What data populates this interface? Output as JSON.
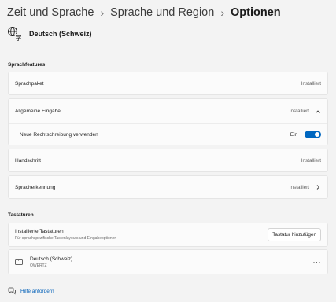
{
  "breadcrumb": {
    "items": [
      "Zeit und Sprache",
      "Sprache und Region",
      "Optionen"
    ],
    "separator": "›"
  },
  "language": {
    "name": "Deutsch (Schweiz)",
    "icon": "language-translate-icon"
  },
  "sprachfeatures": {
    "title": "Sprachfeatures",
    "sprachpaket": {
      "label": "Sprachpaket",
      "status": "Installiert"
    },
    "allgemeine_eingabe": {
      "label": "Allgemeine Eingabe",
      "status": "Installiert",
      "expanded": true,
      "spellcheck": {
        "label": "Neue Rechtschreibung verwenden",
        "state": "Ein",
        "on": true
      }
    },
    "handschrift": {
      "label": "Handschrift",
      "status": "Installiert"
    },
    "spracherkennung": {
      "label": "Spracherkennung",
      "status": "Installiert"
    }
  },
  "tastaturen": {
    "title": "Tastaturen",
    "installed": {
      "label": "Installierte Tastaturen",
      "description": "Für sprachspezifische Tastenlayouts und Eingabeoptionen",
      "add_button": "Tastatur hinzufügen"
    },
    "keyboard": {
      "name": "Deutsch (Schweiz)",
      "layout": "QWERTZ",
      "more": "···"
    }
  },
  "help": {
    "label": "Hilfe anfordern"
  },
  "colors": {
    "accent": "#0067c0",
    "link": "#005fb8",
    "background": "#f3f3f3",
    "card": "#fbfbfb"
  }
}
